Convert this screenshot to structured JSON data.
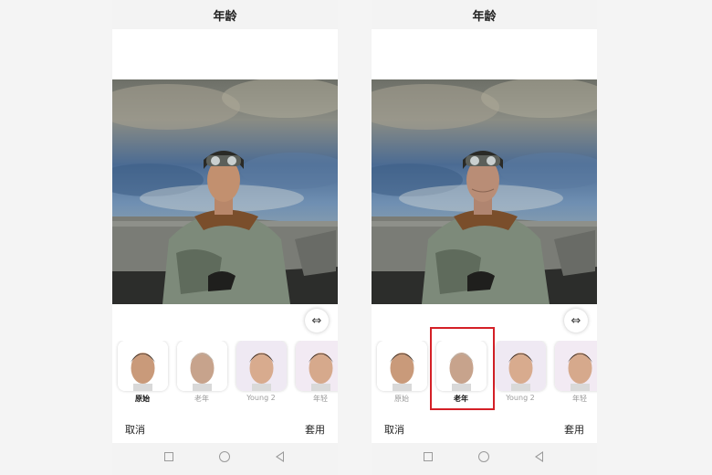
{
  "screens": [
    {
      "title": "年龄",
      "filters": [
        {
          "label": "原始",
          "hair": "#2a2420",
          "skin": "#c99a7a",
          "bg": "#ffffff"
        },
        {
          "label": "老年",
          "hair": "#b9b5ae",
          "skin": "#c7a38c",
          "bg": "#ffffff"
        },
        {
          "label": "Young 2",
          "hair": "#1f1a17",
          "skin": "#d8ab8e",
          "bg": "#efe9f3"
        },
        {
          "label": "年轻",
          "hair": "#241d19",
          "skin": "#d6a98c",
          "bg": "#f2eaf3"
        }
      ],
      "active_index": 0,
      "cancel": "取消",
      "apply": "套用"
    },
    {
      "title": "年龄",
      "filters": [
        {
          "label": "原始",
          "hair": "#2a2420",
          "skin": "#c99a7a",
          "bg": "#ffffff"
        },
        {
          "label": "老年",
          "hair": "#b9b5ae",
          "skin": "#c7a38c",
          "bg": "#ffffff"
        },
        {
          "label": "Young 2",
          "hair": "#1f1a17",
          "skin": "#d8ab8e",
          "bg": "#efe9f3"
        },
        {
          "label": "年轻",
          "hair": "#241d19",
          "skin": "#d6a98c",
          "bg": "#f2eaf3"
        }
      ],
      "active_index": 1,
      "cancel": "取消",
      "apply": "套用"
    }
  ],
  "icons": {
    "compare": "compare-arrows-icon",
    "nav_recent": "square-icon",
    "nav_home": "circle-icon",
    "nav_back": "triangle-back-icon"
  },
  "colors": {
    "selection_border": "#d42027",
    "inactive_label": "#9a9a9a",
    "active_label": "#111111"
  }
}
